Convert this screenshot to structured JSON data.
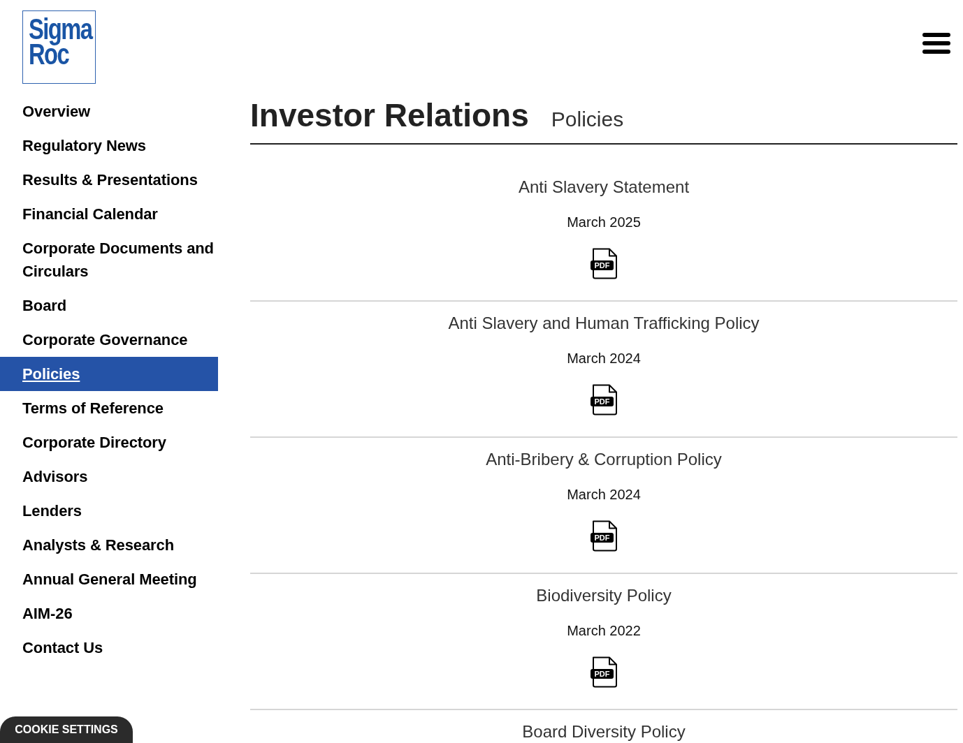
{
  "logo": {
    "lines": [
      "Sigma",
      "Roc"
    ]
  },
  "sidebar": {
    "items": [
      {
        "label": "Overview",
        "selected": false
      },
      {
        "label": "Regulatory News",
        "selected": false
      },
      {
        "label": "Results & Presentations",
        "selected": false
      },
      {
        "label": "Financial Calendar",
        "selected": false
      },
      {
        "label": "Corporate Documents and Circulars",
        "selected": false
      },
      {
        "label": "Board",
        "selected": false
      },
      {
        "label": "Corporate Governance",
        "selected": false
      },
      {
        "label": "Policies",
        "selected": true
      },
      {
        "label": "Terms of Reference",
        "selected": false
      },
      {
        "label": "Corporate Directory",
        "selected": false
      },
      {
        "label": "Advisors",
        "selected": false
      },
      {
        "label": "Lenders",
        "selected": false
      },
      {
        "label": "Analysts & Research",
        "selected": false
      },
      {
        "label": "Annual General Meeting",
        "selected": false
      },
      {
        "label": "AIM-26",
        "selected": false
      },
      {
        "label": "Contact Us",
        "selected": false
      }
    ]
  },
  "page": {
    "title": "Investor Relations",
    "subtitle": "Policies"
  },
  "documents": [
    {
      "title": "Anti Slavery Statement",
      "date": "March 2025",
      "file_label": "PDF"
    },
    {
      "title": "Anti Slavery and Human Trafficking Policy",
      "date": "March 2024",
      "file_label": "PDF"
    },
    {
      "title": "Anti-Bribery & Corruption Policy",
      "date": "March 2024",
      "file_label": "PDF"
    },
    {
      "title": "Biodiversity Policy",
      "date": "March 2022",
      "file_label": "PDF"
    },
    {
      "title": "Board Diversity Policy"
    }
  ],
  "cookie_button": {
    "label": "COOKIE SETTINGS"
  }
}
